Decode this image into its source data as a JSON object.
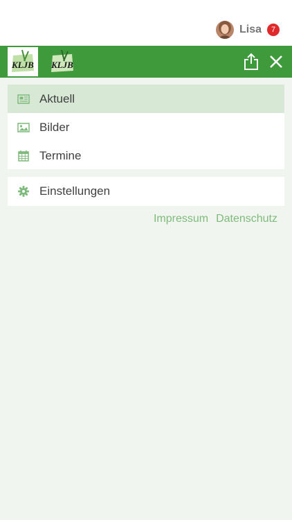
{
  "user": {
    "name": "Lisa",
    "notifications": "7"
  },
  "header": {
    "logo_text_1": "KLJB",
    "logo_text_2": "KLJB"
  },
  "menu": {
    "items": [
      {
        "label": "Aktuell",
        "icon": "newspaper-icon",
        "active": true
      },
      {
        "label": "Bilder",
        "icon": "image-icon",
        "active": false
      },
      {
        "label": "Termine",
        "icon": "calendar-icon",
        "active": false
      }
    ],
    "settings": {
      "label": "Einstellungen",
      "icon": "gear-icon"
    }
  },
  "footer": {
    "impressum": "Impressum",
    "datenschutz": "Datenschutz"
  },
  "colors": {
    "brand_green": "#3f9a3c",
    "active_item_bg": "#d7e9d5",
    "link_green": "#7fb97c",
    "badge_red": "#e0292b"
  }
}
